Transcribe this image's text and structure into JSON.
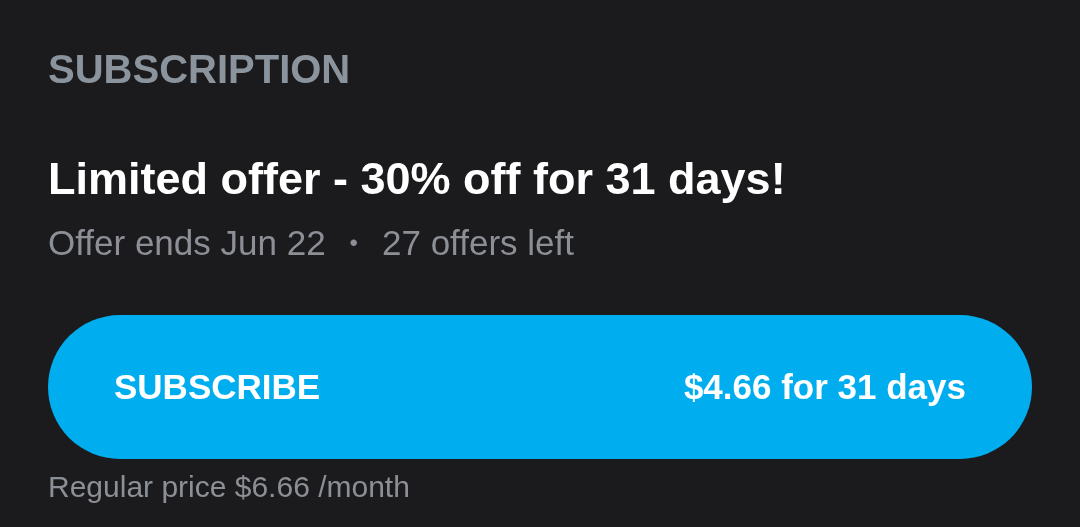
{
  "section_title": "SUBSCRIPTION",
  "offer": {
    "title": "Limited offer - 30% off for 31 days!",
    "ends": "Offer ends Jun 22",
    "separator": "•",
    "remaining": "27 offers left"
  },
  "subscribe_button": {
    "label": "SUBSCRIBE",
    "price": "$4.66 for 31 days"
  },
  "regular_price": "Regular price $6.66 /month"
}
